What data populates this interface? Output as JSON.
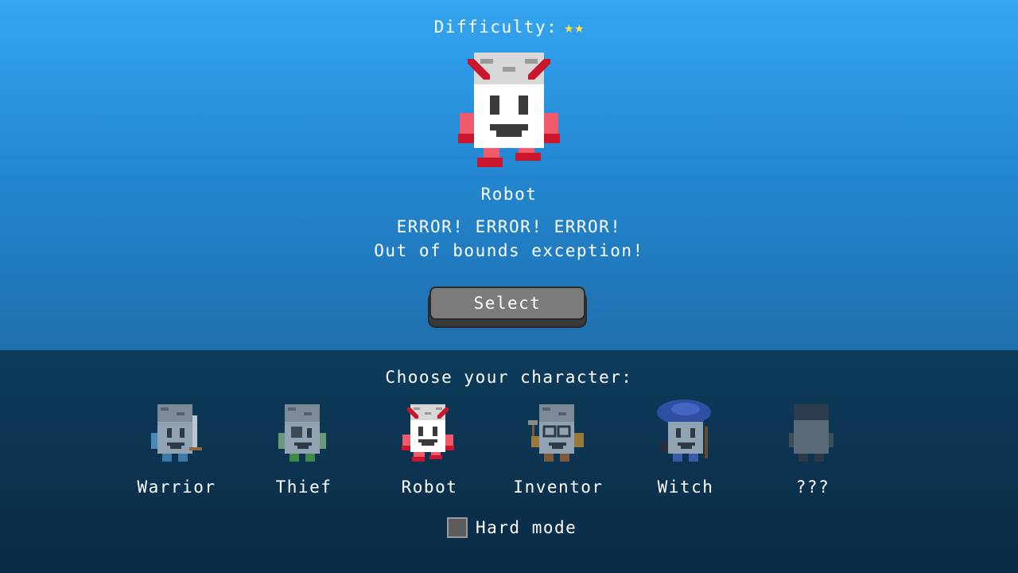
{
  "difficulty": {
    "label": "Difficulty:",
    "stars": 2,
    "star_glyph": "★",
    "star_color": "#ffe14a"
  },
  "selected": {
    "name": "Robot",
    "description_lines": [
      "ERROR! ERROR! ERROR!",
      "Out of bounds exception!"
    ]
  },
  "select_button": {
    "label": "Select"
  },
  "roster": {
    "prompt": "Choose your character:",
    "characters": [
      {
        "name": "Warrior",
        "icon": "warrior-sprite",
        "locked": false,
        "selected": false
      },
      {
        "name": "Thief",
        "icon": "thief-sprite",
        "locked": false,
        "selected": false
      },
      {
        "name": "Robot",
        "icon": "robot-sprite",
        "locked": false,
        "selected": true
      },
      {
        "name": "Inventor",
        "icon": "inventor-sprite",
        "locked": false,
        "selected": false
      },
      {
        "name": "Witch",
        "icon": "witch-sprite",
        "locked": false,
        "selected": false
      },
      {
        "name": "???",
        "icon": "locked-sprite",
        "locked": true,
        "selected": false
      }
    ]
  },
  "hard_mode": {
    "label": "Hard mode",
    "checked": false
  },
  "colors": {
    "sky_top": "#35a6f1",
    "sky_bottom": "#1e6fad",
    "panel": "#0b3350",
    "robot_red": "#e8354a"
  }
}
